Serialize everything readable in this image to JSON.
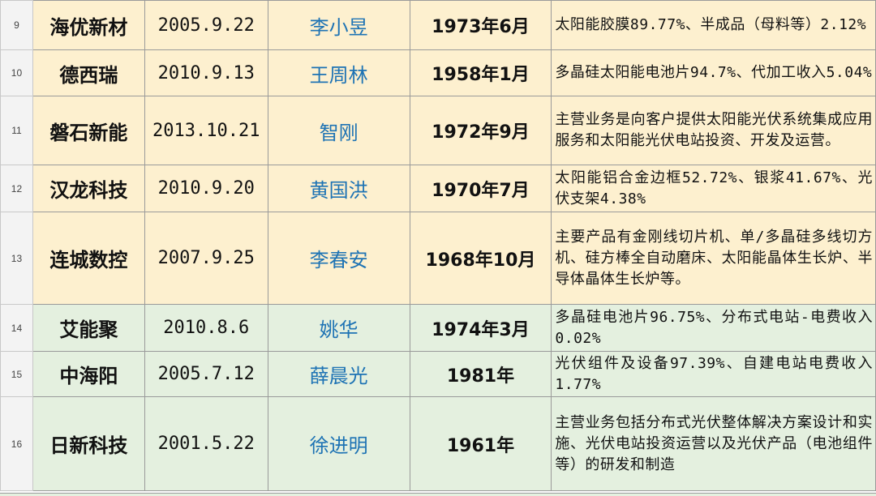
{
  "rows": [
    {
      "row_number": "9",
      "company": "海优新材",
      "founded": "2005.9.22",
      "chairman": "李小昱",
      "birth": "1973年6月",
      "business": "太阳能胶膜89.77%、半成品（母料等）2.12%",
      "color": "yellow"
    },
    {
      "row_number": "10",
      "company": "德西瑞",
      "founded": "2010.9.13",
      "chairman": "王周林",
      "birth": "1958年1月",
      "business": "多晶硅太阳能电池片94.7%、代加工收入5.04%",
      "color": "yellow"
    },
    {
      "row_number": "11",
      "company": "磐石新能",
      "founded": "2013.10.21",
      "chairman": "智刚",
      "birth": "1972年9月",
      "business": "主营业务是向客户提供太阳能光伏系统集成应用服务和太阳能光伏电站投资、开发及运营。",
      "color": "yellow"
    },
    {
      "row_number": "12",
      "company": "汉龙科技",
      "founded": "2010.9.20",
      "chairman": "黄国洪",
      "birth": "1970年7月",
      "business": "太阳能铝合金边框52.72%、银浆41.67%、光伏支架4.38%",
      "color": "yellow"
    },
    {
      "row_number": "13",
      "company": "连城数控",
      "founded": "2007.9.25",
      "chairman": "李春安",
      "birth": "1968年10月",
      "business": "主要产品有金刚线切片机、单/多晶硅多线切方机、硅方棒全自动磨床、太阳能晶体生长炉、半导体晶体生长炉等。",
      "color": "yellow"
    },
    {
      "row_number": "14",
      "company": "艾能聚",
      "founded": "2010.8.6",
      "chairman": "姚华",
      "birth": "1974年3月",
      "business": "多晶硅电池片96.75%、分布式电站-电费收入0.02%",
      "color": "green"
    },
    {
      "row_number": "15",
      "company": "中海阳",
      "founded": "2005.7.12",
      "chairman": "薛晨光",
      "birth": "1981年",
      "business": "光伏组件及设备97.39%、自建电站电费收入1.77%",
      "color": "green"
    },
    {
      "row_number": "16",
      "company": "日新科技",
      "founded": "2001.5.22",
      "chairman": "徐进明",
      "birth": "1961年",
      "business": "主营业务包括分布式光伏整体解决方案设计和实施、光伏电站投资运营以及光伏产品（电池组件等）的研发和制造",
      "color": "green"
    }
  ],
  "colors": {
    "yellow_fill": "#fdf0cf",
    "green_fill": "#e4f0df",
    "name_blue": "#1e73b4"
  }
}
